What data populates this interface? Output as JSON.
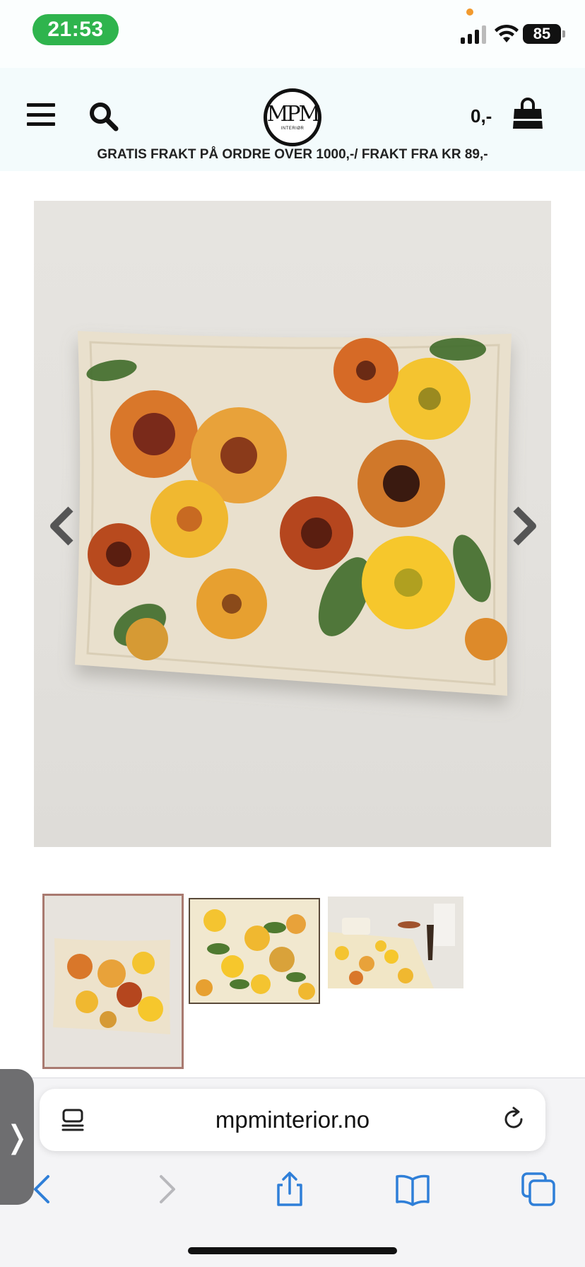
{
  "status_bar": {
    "time": "21:53",
    "battery": "85",
    "signal_bars": 3,
    "colors": {
      "time_pill": "#2fb44d",
      "indicator_dot": "#f29a2e"
    }
  },
  "header": {
    "logo_mark": "MPM",
    "logo_sub": "INTERIØR",
    "cart_total": "0,-",
    "promo": "GRATIS FRAKT PÅ ORDRE OVER 1000,-/ FRAKT FRA KR 89,-",
    "icons": [
      "menu-icon",
      "search-icon",
      "shopping-bag-icon"
    ]
  },
  "gallery": {
    "thumbnail_count": 3,
    "selected_thumbnail": 1,
    "icons": [
      "chevron-left-icon",
      "chevron-right-icon"
    ]
  },
  "browser": {
    "url": "mpminterior.no",
    "side_tab_glyph": "❭",
    "icons": [
      "reader-icon",
      "reload-icon",
      "back-icon",
      "forward-icon",
      "share-icon",
      "bookmarks-icon",
      "tabs-icon"
    ],
    "accent": "#2f7fd8"
  }
}
